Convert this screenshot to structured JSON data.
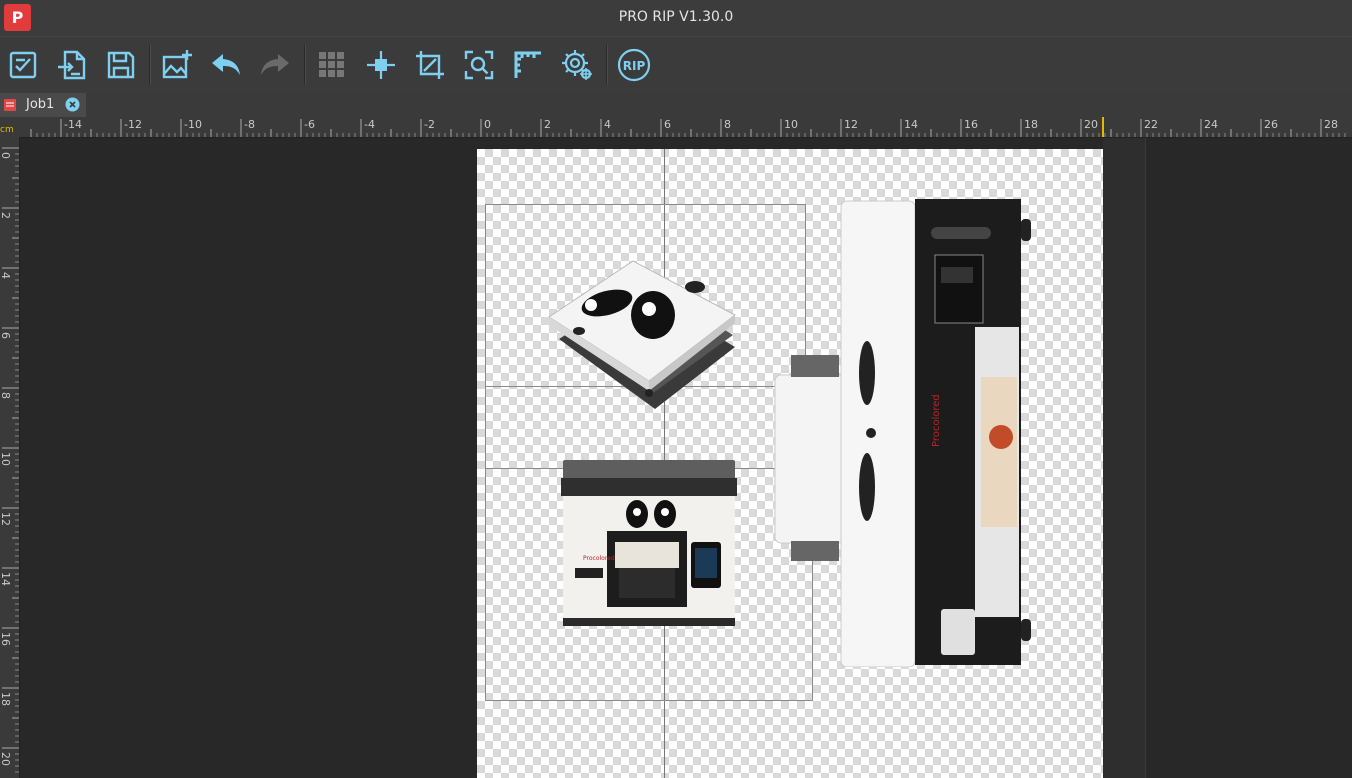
{
  "app": {
    "title": "PRO RIP V1.30.0",
    "logo": "P"
  },
  "toolbar": {
    "items": [
      {
        "name": "new-job-icon"
      },
      {
        "name": "import-icon"
      },
      {
        "name": "save-icon"
      },
      {
        "name": "add-image-icon"
      },
      {
        "name": "undo-icon"
      },
      {
        "name": "redo-icon"
      },
      {
        "name": "grid-icon"
      },
      {
        "name": "align-center-icon"
      },
      {
        "name": "crop-icon"
      },
      {
        "name": "zoom-fit-icon"
      },
      {
        "name": "ruler-icon"
      },
      {
        "name": "settings-icon"
      },
      {
        "name": "rip-icon",
        "label": "RIP"
      }
    ]
  },
  "tabs": [
    {
      "label": "Job1"
    }
  ],
  "ruler": {
    "unit": "cm",
    "h_labels": [
      "-14",
      "-12",
      "-10",
      "-8",
      "-6",
      "-4",
      "-2",
      "0",
      "2",
      "4",
      "6",
      "8",
      "10",
      "12",
      "14",
      "16",
      "18",
      "20",
      "22",
      "24",
      "26",
      "28"
    ],
    "v_labels": [
      "0",
      "2",
      "4",
      "6",
      "8",
      "10",
      "12",
      "14",
      "16",
      "18",
      "20"
    ]
  },
  "colors": {
    "accent": "#7fd0f0",
    "brand": "#e23b3b",
    "ruler_marker": "#e6b800"
  }
}
